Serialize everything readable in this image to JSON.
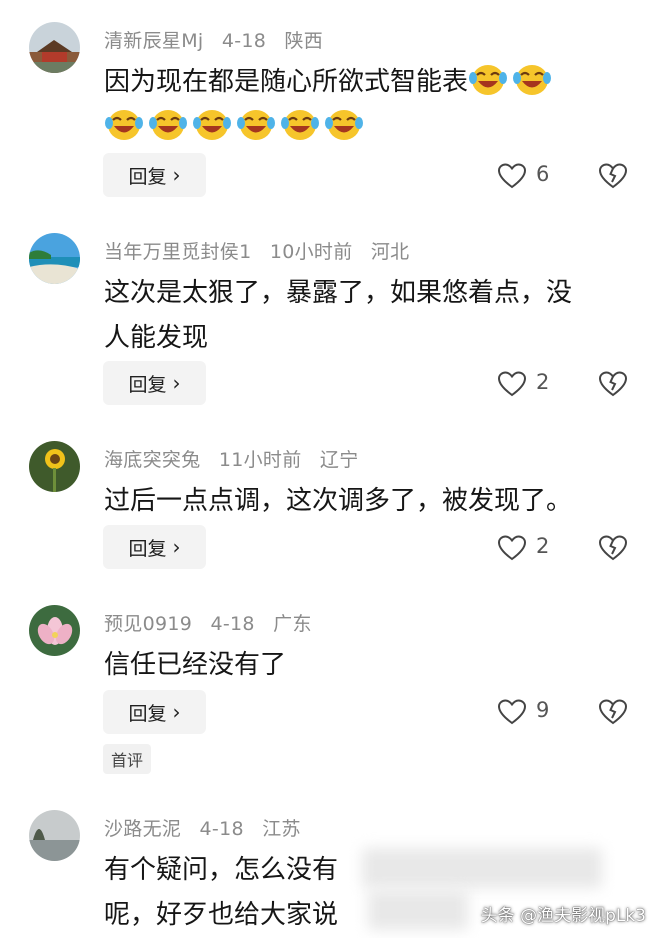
{
  "comments": [
    {
      "username": "清新辰星Mj",
      "time": "4-18",
      "location": "陕西",
      "text": "因为现在都是随心所欲式智能表",
      "emojis": [
        "laugh-cry-emoji",
        "laugh-cry-emoji",
        "laugh-cry-emoji",
        "laugh-cry-emoji",
        "laugh-cry-emoji",
        "laugh-cry-emoji",
        "laugh-cry-emoji",
        "laugh-cry-emoji"
      ],
      "reply_label": "回复",
      "likes": "6"
    },
    {
      "username": "当年万里觅封侯1",
      "time": "10小时前",
      "location": "河北",
      "text_line1": "这次是太狠了，暴露了，如果悠着点，没",
      "text_line2": "人能发现",
      "reply_label": "回复",
      "likes": "2"
    },
    {
      "username": "海底突突兔",
      "time": "11小时前",
      "location": "辽宁",
      "text": "过后一点点调，这次调多了，被发现了。",
      "reply_label": "回复",
      "likes": "2"
    },
    {
      "username": "预见0919",
      "time": "4-18",
      "location": "广东",
      "text": "信任已经没有了",
      "reply_label": "回复",
      "likes": "9",
      "tag": "首评"
    },
    {
      "username": "沙路无泥",
      "time": "4-18",
      "location": "江苏",
      "text_line1": "有个疑问，怎么没有",
      "text_line2": "呢，好歹也给大家说"
    }
  ],
  "watermark": "头条 @渔夫影视pLk3",
  "colors": {
    "meta_gray": "#8b8b8b",
    "button_bg": "#f3f3f3",
    "emoji_yellow": "#f6c52b"
  }
}
